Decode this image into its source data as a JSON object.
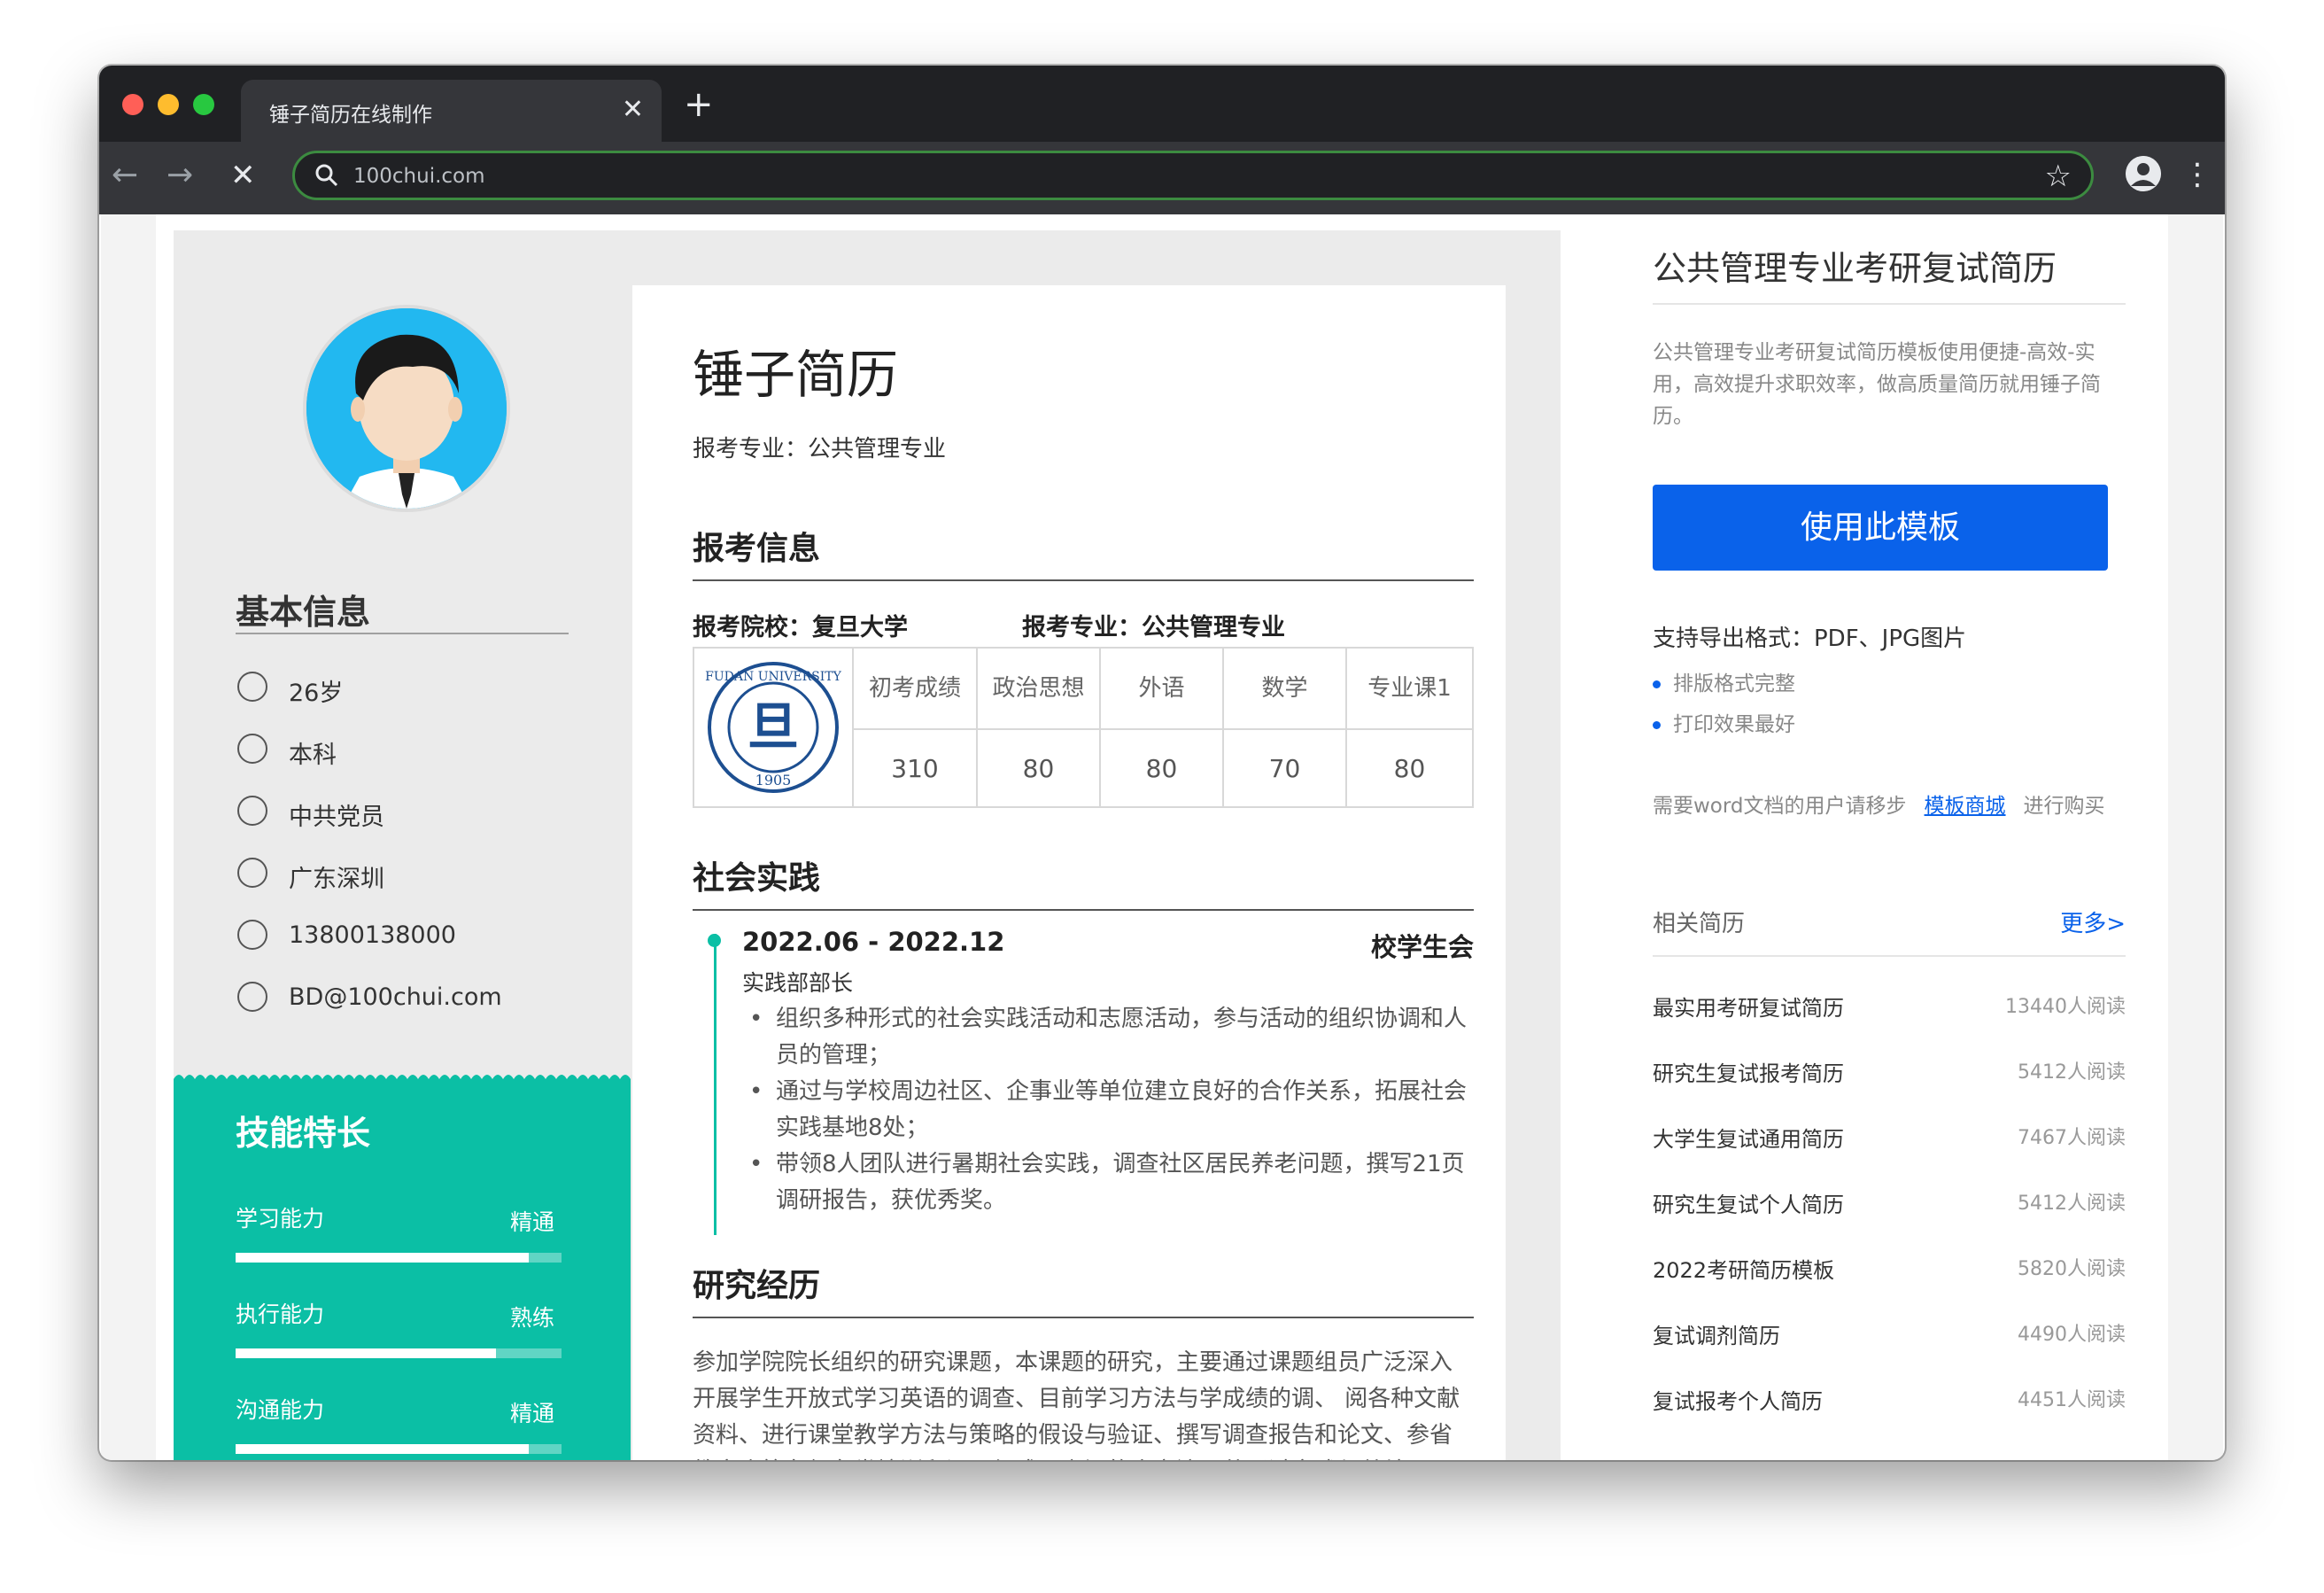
{
  "browser": {
    "tab_title": "锤子简历在线制作",
    "url": "100chui.com",
    "traffic_colors": [
      "#ff5f57",
      "#febc2e",
      "#28c840"
    ]
  },
  "sidebar": {
    "basic_title": "基本信息",
    "info": [
      {
        "icon": "age-icon",
        "text": "26岁"
      },
      {
        "icon": "education-icon",
        "text": "本科"
      },
      {
        "icon": "party-icon",
        "text": "中共党员"
      },
      {
        "icon": "location-icon",
        "text": "广东深圳"
      },
      {
        "icon": "phone-icon",
        "text": "13800138000"
      },
      {
        "icon": "email-icon",
        "text": "BD@100chui.com"
      }
    ],
    "skills_title": "技能特长",
    "skills": [
      {
        "name": "学习能力",
        "level": "精通",
        "fraction": 0.9
      },
      {
        "name": "执行能力",
        "level": "熟练",
        "fraction": 0.8
      },
      {
        "name": "沟通能力",
        "level": "精通",
        "fraction": 0.9
      }
    ]
  },
  "resume": {
    "name": "锤子简历",
    "major_line": "报考专业：公共管理专业",
    "section_apply": "报考信息",
    "apply_school": "报考院校：复旦大学",
    "apply_major": "报考专业：公共管理专业",
    "school_logo_alt": "FUDAN UNIVERSITY 1905",
    "score_headers": [
      "初考成绩",
      "政治思想",
      "外语",
      "数学",
      "专业课1"
    ],
    "score_values": [
      "310",
      "80",
      "80",
      "70",
      "80"
    ],
    "section_practice": "社会实践",
    "practice": {
      "date": "2022.06 - 2022.12",
      "org": "校学生会",
      "role": "实践部部长",
      "bullets": [
        "组织多种形式的社会实践活动和志愿活动，参与活动的组织协调和人员的管理；",
        "通过与学校周边社区、企事业等单位建立良好的合作关系，拓展社会实践基地8处；",
        "带领8人团队进行暑期社会实践，调查社区居民养老问题，撰写21页调研报告，获优秀奖。"
      ]
    },
    "section_research": "研究经历",
    "research_text": "参加学院院长组织的研究课题，本课题的研究，主要通过课题组员广泛深入开展学生开放式学习英语的调查、目前学习方法与学成绩的调、 阅各种文献资料、进行课堂教学方法与策略的假设与验证、撰写调查报告和论文、参省教育会等各级各类培训和课题组成员之间的广交流，共通过实践与总结"
  },
  "right_panel": {
    "title": "公共管理专业考研复试简历",
    "description": "公共管理专业考研复试简历模板使用便捷-高效-实用，高效提升求职效率，做高质量简历就用锤子简历。",
    "use_button": "使用此模板",
    "export_formats": "支持导出格式：PDF、JPG图片",
    "features": [
      "排版格式完整",
      "打印效果最好"
    ],
    "word_prefix": "需要word文档的用户请移步",
    "word_link": "模板商城",
    "word_suffix": "进行购买",
    "related_title": "相关简历",
    "related_more": "更多>",
    "related": [
      {
        "name": "最实用考研复试简历",
        "views": "13440人阅读"
      },
      {
        "name": "研究生复试报考简历",
        "views": "5412人阅读"
      },
      {
        "name": "大学生复试通用简历",
        "views": "7467人阅读"
      },
      {
        "name": "研究生复试个人简历",
        "views": "5412人阅读"
      },
      {
        "name": "2022考研简历模板",
        "views": "5820人阅读"
      },
      {
        "name": "复试调剂简历",
        "views": "4490人阅读"
      },
      {
        "name": "复试报考个人简历",
        "views": "4451人阅读"
      }
    ]
  }
}
